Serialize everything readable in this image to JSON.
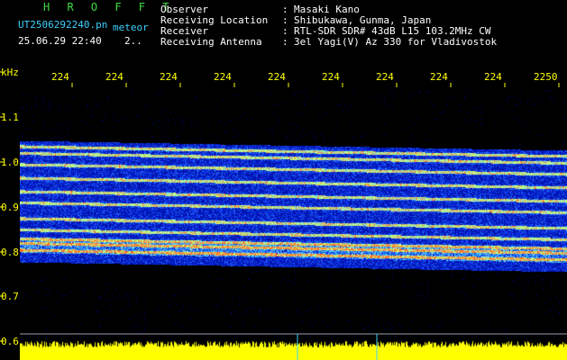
{
  "app": {
    "title": "H R O F F T"
  },
  "file": {
    "name": "UT2506292240.pn",
    "name_suffix": "meteor",
    "date": "25.06.29 22:40",
    "extra": "2.."
  },
  "station": {
    "fields": [
      {
        "label": "Observer",
        "value": "Masaki Kano"
      },
      {
        "label": "Receiving Location",
        "value": "Shibukawa, Gunma, Japan"
      },
      {
        "label": "Receiver",
        "value": "RTL-SDR SDR# 43dB L15 103.2MHz CW"
      },
      {
        "label": "Receiving Antenna",
        "value": "3el Yagi(V) Az 330 for Vladivostok"
      }
    ]
  },
  "axes": {
    "y_unit": "kHz",
    "y_ticks": [
      "1.1",
      "1.0",
      "0.9",
      "0.8",
      "0.7",
      "0.6"
    ],
    "x_ticks": [
      "224",
      "224",
      "224",
      "224",
      "224",
      "224",
      "224",
      "224",
      "224",
      "2250"
    ]
  },
  "colors": {
    "background": "#000000",
    "title": "#3fdc3f",
    "info_text": "#3fd0ff",
    "axis_labels": "#ffff00",
    "noise_floor": "#ffff00",
    "spectrogram_base": "#000080"
  },
  "spectrogram": {
    "signal_lines_khz": [
      1.035,
      1.02,
      0.995,
      0.965,
      0.935,
      0.91,
      0.875,
      0.85,
      0.83,
      0.82,
      0.805
    ],
    "noise_band_khz": [
      0.79,
      1.04
    ]
  }
}
